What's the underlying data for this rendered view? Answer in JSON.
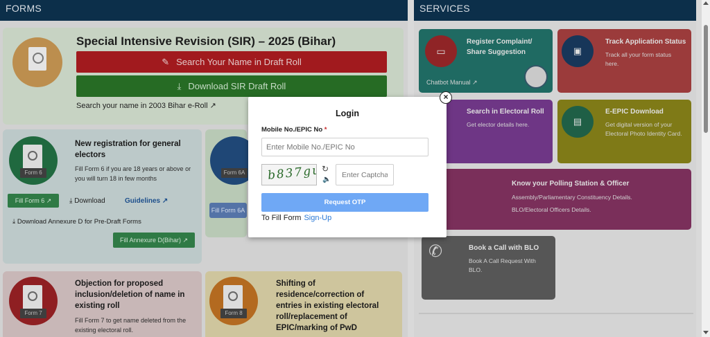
{
  "forms": {
    "header": "FORMS",
    "sir": {
      "title": "Special Intensive Revision (SIR) – 2025 (Bihar)",
      "search_button": "Search Your Name in Draft Roll",
      "download_button": "Download SIR Draft Roll",
      "eroll_link": "Search your name in 2003 Bihar e-Roll ↗"
    },
    "form6": {
      "tag": "Form 6",
      "title": "New registration for general electors",
      "desc": "Fill Form 6 if you are 18 years or above or you will turn 18 in few months",
      "fill_label": "Fill Form 6 ↗",
      "download_label": "⤓ Download",
      "guidelines_label": "Guidelines ↗",
      "annexure_download": "⤓ Download Annexure D for Pre-Draft Forms",
      "annexure_fill": "Fill Annexure D(Bihar) ↗"
    },
    "form6a": {
      "tag": "Form 6A",
      "fill_label": "Fill Form 6A"
    },
    "form7": {
      "tag": "Form 7",
      "title": "Objection for proposed inclusion/deletion of name in existing roll",
      "desc": "Fill Form 7 to get name deleted from the existing electoral roll."
    },
    "form8": {
      "tag": "Form 8",
      "title": "Shifting of residence/correction of entries in existing electoral roll/replacement of EPIC/marking of PwD"
    }
  },
  "services": {
    "header": "SERVICES",
    "items": [
      {
        "title": "Register Complaint/ Share Suggestion",
        "desc": "",
        "extra": "Chatbot Manual ↗"
      },
      {
        "title": "Track Application Status",
        "desc": "Track all your form status here."
      },
      {
        "title": "Search in Electoral Roll",
        "desc": "Get elector details here."
      },
      {
        "title": "E-EPIC Download",
        "desc": "Get digital version of your Electoral Photo Identity Card."
      },
      {
        "title": "Know your Polling Station & Officer",
        "desc1": "Assembly/Parliamentary Constituency Details.",
        "desc2": "BLO/Electoral Officers Details."
      },
      {
        "title": "Book a Call with BLO",
        "desc": "Book A Call Request With BLO."
      }
    ]
  },
  "login": {
    "close": "×",
    "title": "Login",
    "field_label": "Mobile No./EPIC No",
    "required_mark": "*",
    "mobile_placeholder": "Enter Mobile No./EPIC No",
    "captcha_text": "b837gu",
    "captcha_placeholder": "Enter Captcha",
    "otp_button": "Request OTP",
    "fill_form_text": "To Fill Form",
    "signup_link": "Sign-Up"
  }
}
